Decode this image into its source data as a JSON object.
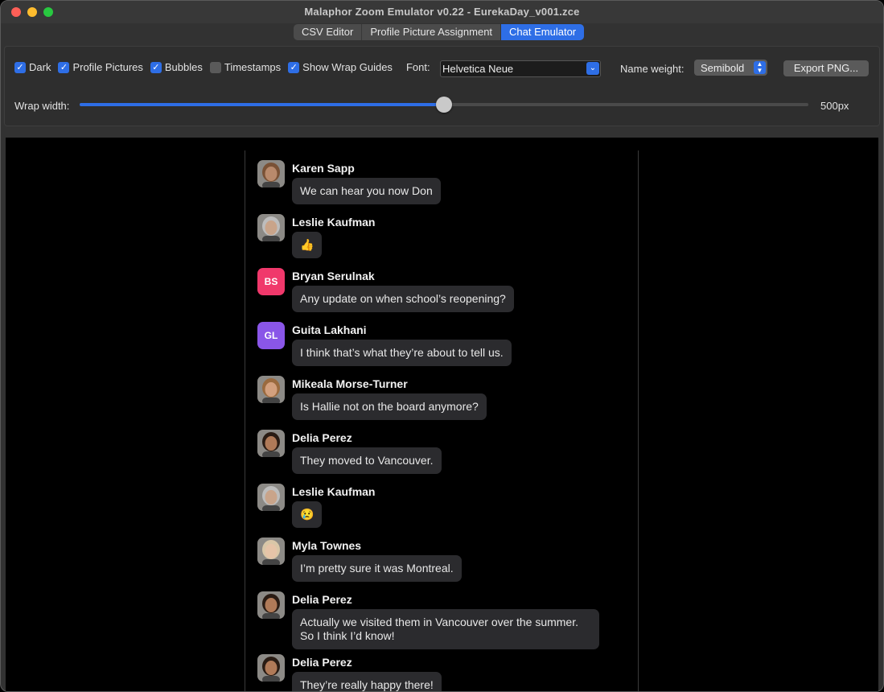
{
  "window": {
    "title": "Malaphor Zoom Emulator v0.22 - EurekaDay_v001.zce"
  },
  "tabs": [
    {
      "label": "CSV Editor"
    },
    {
      "label": "Profile Picture Assignment"
    },
    {
      "label": "Chat Emulator",
      "active": true
    }
  ],
  "options": {
    "checkboxes": [
      {
        "label": "Dark",
        "checked": true
      },
      {
        "label": "Profile Pictures",
        "checked": true
      },
      {
        "label": "Bubbles",
        "checked": true
      },
      {
        "label": "Timestamps",
        "checked": false
      },
      {
        "label": "Show Wrap Guides",
        "checked": true
      }
    ],
    "font_label": "Font:",
    "font_value": "Helvetica Neue",
    "name_weight_label": "Name weight:",
    "name_weight_value": "Semibold",
    "export_label": "Export PNG...",
    "wrap_label": "Wrap width:",
    "wrap_value": "500px",
    "wrap_fraction": 0.5
  },
  "messages": [
    {
      "name": "Karen Sapp",
      "text": "We can hear you now Don",
      "avatar": "photo",
      "tone": "#b98a6c",
      "hair": "#7a5236"
    },
    {
      "name": "Leslie Kaufman",
      "text": "👍",
      "avatar": "photo",
      "tone": "#c9a48a",
      "hair": "#bdbdbd"
    },
    {
      "name": "Bryan Serulnak",
      "text": "Any update on when school’s reopening?",
      "avatar": "initials",
      "initials": "BS",
      "color": "#f0386b"
    },
    {
      "name": "Guita Lakhani",
      "text": "I think that’s what they’re about to tell us.",
      "avatar": "initials",
      "initials": "GL",
      "color": "#8a56e8"
    },
    {
      "name": "Mikeala Morse-Turner",
      "text": "Is Hallie not on the board anymore?",
      "avatar": "photo",
      "tone": "#d3a07e",
      "hair": "#9a6a3e"
    },
    {
      "name": "Delia Perez",
      "text": "They moved to Vancouver.",
      "avatar": "photo",
      "tone": "#b07a58",
      "hair": "#2a1c14"
    },
    {
      "name": "Leslie Kaufman",
      "text": "😢",
      "avatar": "photo",
      "tone": "#c9a48a",
      "hair": "#bdbdbd"
    },
    {
      "name": "Myla Townes",
      "text": "I’m pretty sure it was Montreal.",
      "avatar": "photo",
      "tone": "#e6c4a8",
      "hair": "#d9c7a8"
    },
    {
      "name": "Delia Perez",
      "text": "Actually we visited them in Vancouver over the summer. So I think I’d know!",
      "avatar": "photo",
      "tone": "#b07a58",
      "hair": "#2a1c14"
    },
    {
      "name": "Delia Perez",
      "text": "They’re really happy there!",
      "avatar": "photo",
      "tone": "#b07a58",
      "hair": "#2a1c14"
    }
  ]
}
